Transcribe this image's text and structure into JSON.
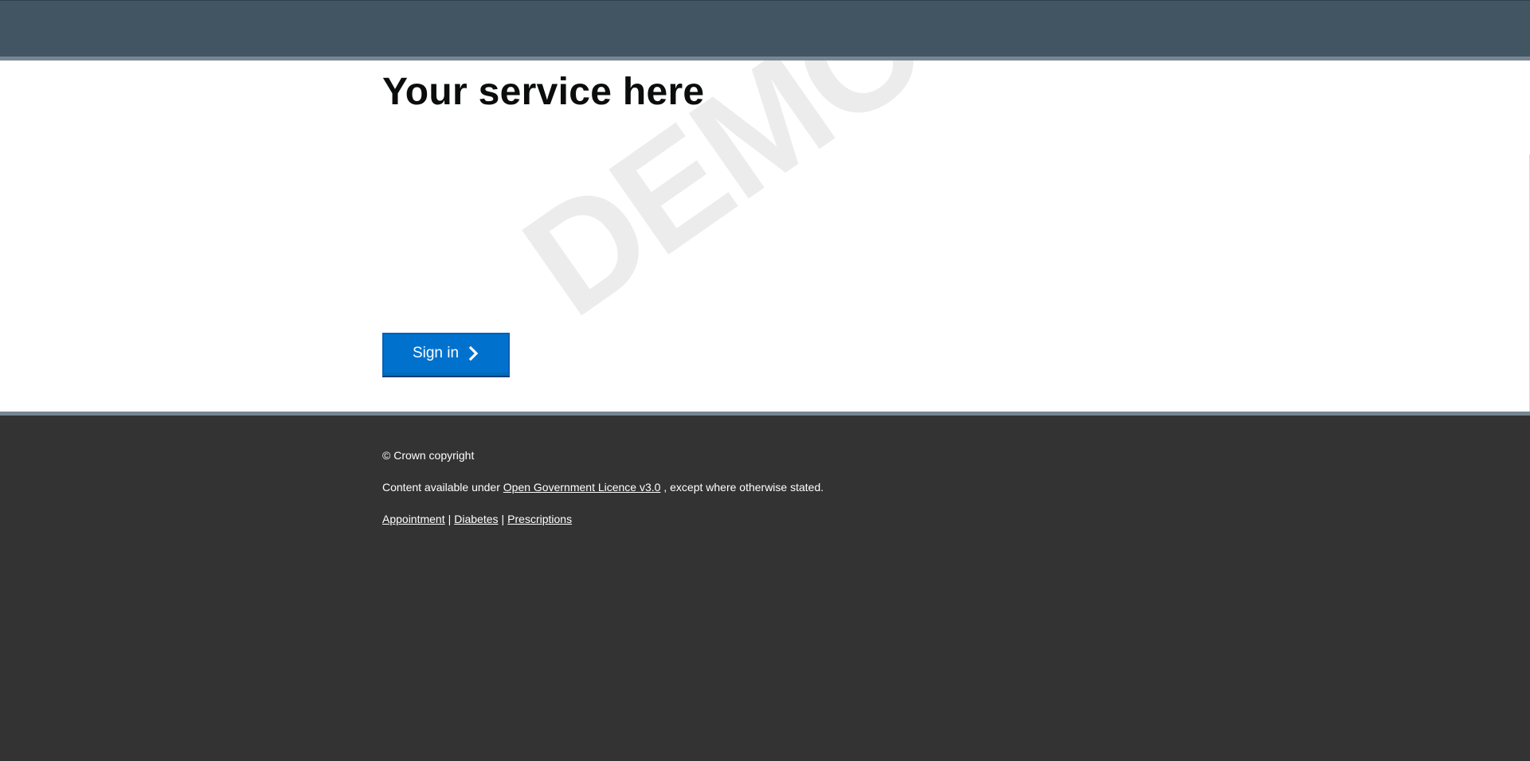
{
  "header": {
    "background_color": "#425563"
  },
  "main": {
    "title": "Your service here",
    "watermark": "DEMO",
    "signin_button": {
      "label": "Sign in",
      "icon": "chevron-right-icon",
      "color": "#0072ce"
    }
  },
  "footer": {
    "copyright": "© Crown copyright",
    "licence_prefix": "Content available under",
    "licence_link": "Open Government Licence v3.0",
    "licence_suffix": ", except where otherwise stated.",
    "links": [
      {
        "label": "Appointment"
      },
      {
        "label": "Diabetes"
      },
      {
        "label": "Prescriptions"
      }
    ],
    "link_separator": "|",
    "background_color": "#333333"
  }
}
